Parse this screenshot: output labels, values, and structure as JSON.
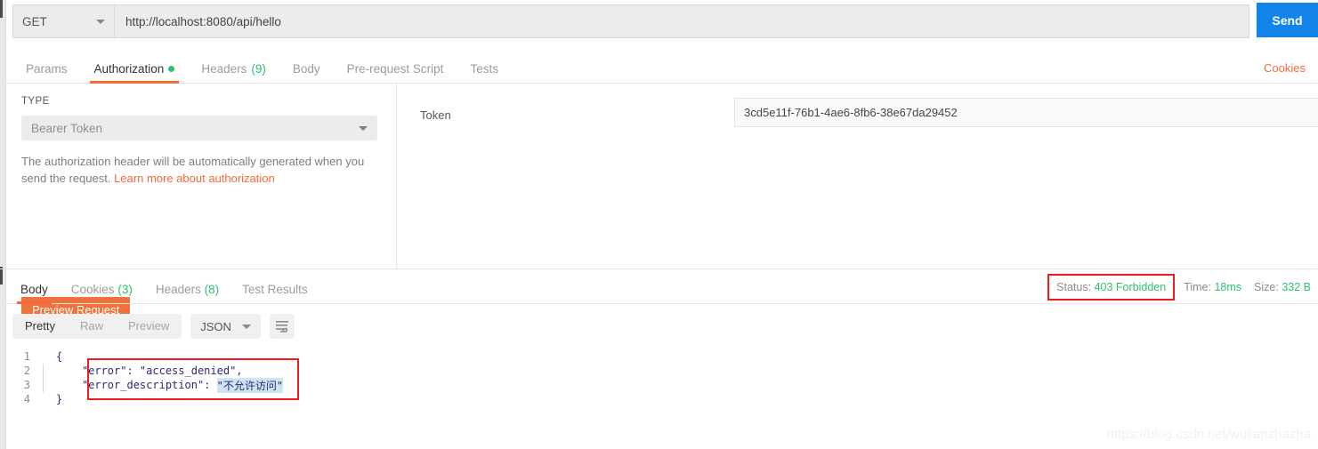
{
  "request": {
    "method": "GET",
    "url": "http://localhost:8080/api/hello",
    "send_label": "Send",
    "cookies_label": "Cookies",
    "tabs": [
      {
        "label": "Params",
        "badge": "",
        "dot": false
      },
      {
        "label": "Authorization",
        "badge": "",
        "dot": true
      },
      {
        "label": "Headers",
        "badge": "(9)",
        "dot": false
      },
      {
        "label": "Body",
        "badge": "",
        "dot": false
      },
      {
        "label": "Pre-request Script",
        "badge": "",
        "dot": false
      },
      {
        "label": "Tests",
        "badge": "",
        "dot": false
      }
    ]
  },
  "auth": {
    "type_label": "TYPE",
    "type_value": "Bearer Token",
    "help_text": "The authorization header will be automatically generated when you send the request. ",
    "help_link": "Learn more about authorization",
    "preview_label": "Preview Request",
    "token_label": "Token",
    "token_value": "3cd5e11f-76b1-4ae6-8fb6-38e67da29452"
  },
  "response": {
    "tabs": [
      {
        "label": "Body",
        "badge": ""
      },
      {
        "label": "Cookies",
        "badge": "(3)"
      },
      {
        "label": "Headers",
        "badge": "(8)"
      },
      {
        "label": "Test Results",
        "badge": ""
      }
    ],
    "status_label": "Status:",
    "status_value": "403 Forbidden",
    "time_label": "Time:",
    "time_value": "18ms",
    "size_label": "Size:",
    "size_value": "332 B",
    "view_modes": [
      "Pretty",
      "Raw",
      "Preview"
    ],
    "format": "JSON",
    "body_lines": [
      {
        "num": "1",
        "guide": false,
        "text": "{",
        "highlight": ""
      },
      {
        "num": "2",
        "guide": true,
        "text": "    \"error\": \"access_denied\",",
        "highlight": ""
      },
      {
        "num": "3",
        "guide": true,
        "text": "    \"error_description\": ",
        "highlight": "\"不允许访问\""
      },
      {
        "num": "4",
        "guide": false,
        "text": "}",
        "highlight": ""
      }
    ]
  },
  "watermark": "https://blog.csdn.net/wulianzhazha",
  "colors": {
    "send_blue": "#1384e8",
    "accent_orange": "#f26b3a",
    "status_green": "#2fbf71",
    "annotation_red": "#ee1c1c"
  }
}
